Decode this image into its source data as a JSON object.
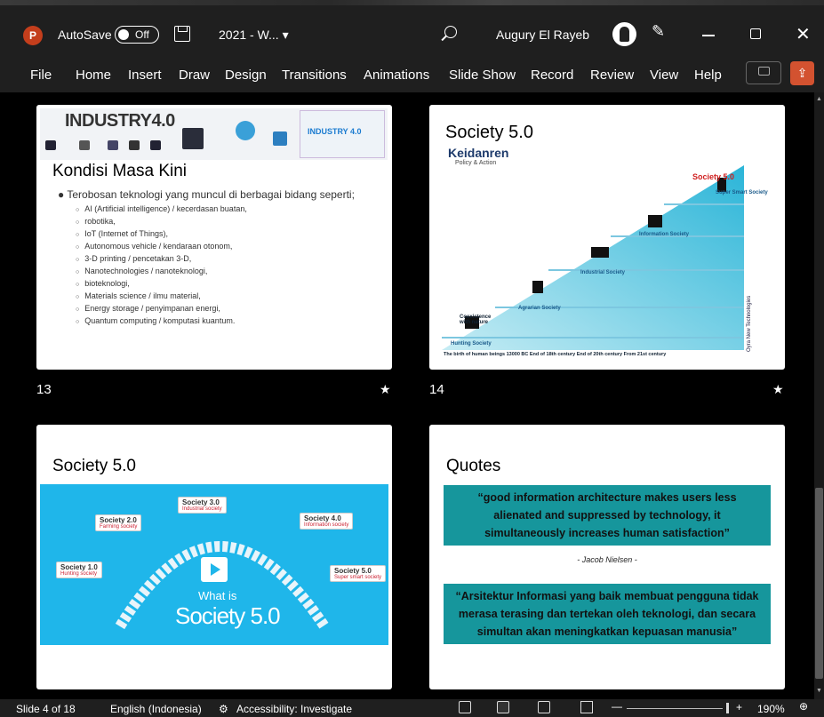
{
  "titlebar": {
    "autosave_label": "AutoSave",
    "toggle_state": "Off",
    "filename": "2021 - W... ▾",
    "username": "Augury El Rayeb",
    "app_letter": "P"
  },
  "menu": {
    "items": [
      "File",
      "Home",
      "Insert",
      "Draw",
      "Design",
      "Transitions",
      "Animations",
      "Slide Show",
      "Record",
      "Review",
      "View",
      "Help"
    ]
  },
  "slides": {
    "s13": {
      "number": "13",
      "banner_title": "INDUSTRY4.0",
      "banner_right": "INDUSTRY 4.0",
      "title": "Kondisi Masa Kini",
      "bullet": "Terobosan teknologi yang muncul di berbagai bidang seperti;",
      "sub_items": [
        "AI (Artificial intelligence) / kecerdasan buatan,",
        "robotika,",
        "IoT (Internet of Things),",
        "Autonomous vehicle / kendaraan otonom,",
        "3-D printing / pencetakan 3-D,",
        "Nanotechnologies / nanoteknologi,",
        "bioteknologi,",
        "Materials science / ilmu material,",
        "Energy storage / penyimpanan energi,",
        "Quantum computing / komputasi kuantum."
      ]
    },
    "s14": {
      "number": "14",
      "title": "Society 5.0",
      "subtitle": "Keidanren",
      "policy": "Policy & Action",
      "society50": "Society 5.0",
      "super_smart": "Super Smart Society",
      "information": "Information Society",
      "industrial": "Industrial Society",
      "agrarian": "Agrarian Society",
      "hunting": "Hunting Society",
      "coexistence": "Coexistence with nature",
      "timeline": "The birth of human beings        13000 BC                    End of 18th century    End of 20th century    From 21st century",
      "vertical": "Oyra New Technologies"
    },
    "s15": {
      "title": "Society 5.0",
      "badge1": "Society 1.0",
      "badge1_sub": "Hunting society",
      "badge2": "Society 2.0",
      "badge2_sub": "Farming society",
      "badge3": "Society 3.0",
      "badge3_sub": "Industrial society",
      "badge4": "Society 4.0",
      "badge4_sub": "Information society",
      "badge5": "Society 5.0",
      "badge5_sub": "Super smart society",
      "what_is": "What is",
      "big": "Society 5.0"
    },
    "s16": {
      "title": "Quotes",
      "quote1": "“good information architecture makes users less alienated and suppressed by technology, it simultaneously increases human satisfaction”",
      "author": "- Jacob Nielsen -",
      "quote2": "“Arsitektur Informasi yang baik membuat pengguna tidak merasa terasing dan tertekan oleh teknologi, dan secara simultan akan meningkatkan kepuasan manusia”"
    }
  },
  "status": {
    "slide": "Slide 4 of 18",
    "language": "English (Indonesia)",
    "accessibility": "Accessibility: Investigate",
    "zoom": "190%",
    "plus": "+"
  },
  "colors": {
    "accent": "#d35230",
    "quote_bg": "#16969c",
    "video_bg": "#1fb6ea"
  }
}
